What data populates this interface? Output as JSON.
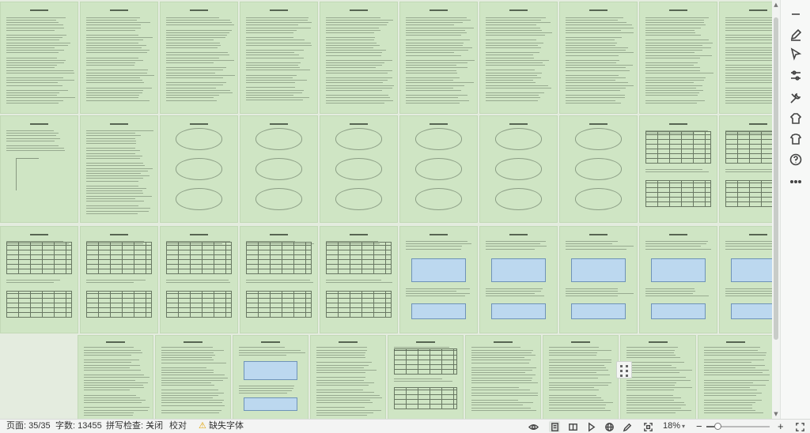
{
  "status_bar": {
    "page_indicator": "页面: 35/35",
    "word_count": "字数: 13455",
    "spell_check": "拼写检查: 关闭",
    "proofread": "校对",
    "missing_fonts": "缺失字体",
    "missing_fonts_icon": "warning-icon",
    "zoom_level": "18%",
    "zoom_fraction": 0.18,
    "view_icons": [
      "eye-icon",
      "page-view-icon",
      "read-mode-icon",
      "play-icon",
      "web-view-icon",
      "pen-icon",
      "fit-page-icon"
    ]
  },
  "toolbar_rail": {
    "icons": [
      "minimize-icon",
      "edit-pen-icon",
      "cursor-select-icon",
      "adjust-settings-icon",
      "tools-icon",
      "cloud-shirt-icon",
      "shirt-icon",
      "help-icon",
      "more-icon"
    ]
  },
  "document": {
    "page_background": "#cfe5c4",
    "canvas_background": "#e4ecdf",
    "visible_headings": [
      "第二章",
      "Abstract",
      "目  录",
      "1 绪论",
      "2 系统分析",
      "3 系统设计",
      "4 系统实现",
      "5 系统测试",
      "结  论",
      "致  谢",
      "参考文献"
    ]
  }
}
